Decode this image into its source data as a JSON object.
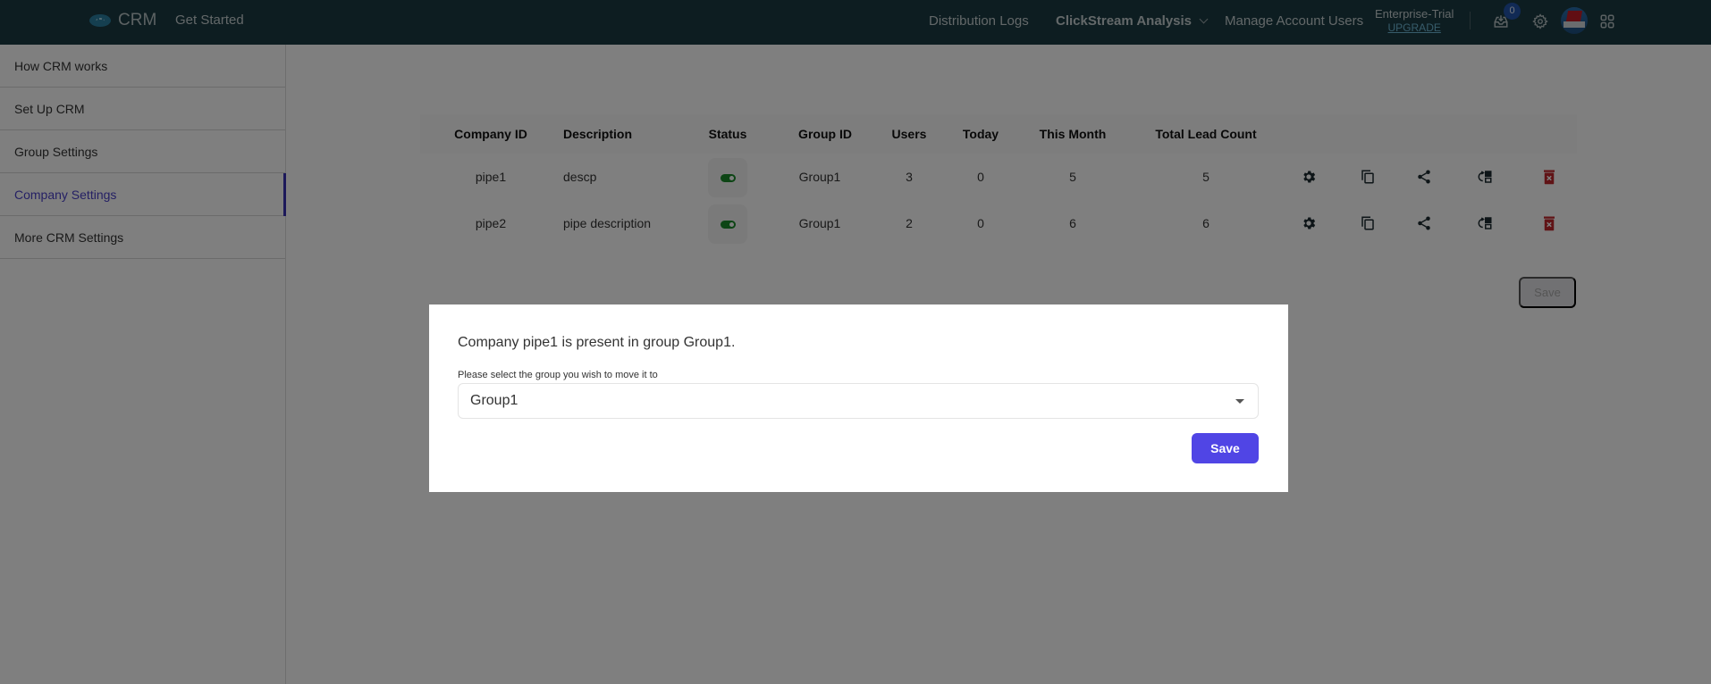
{
  "topbar": {
    "brand": "CRM",
    "get_started": "Get Started",
    "nav": [
      {
        "label": "Distribution Logs"
      },
      {
        "label": "ClickStream Analysis"
      },
      {
        "label": "Manage Account Users"
      }
    ],
    "plan": {
      "name": "Enterprise-Trial",
      "upgrade": "UPGRADE"
    },
    "notifications_count": "0"
  },
  "sidebar": {
    "items": [
      {
        "label": "How CRM works"
      },
      {
        "label": "Set Up CRM"
      },
      {
        "label": "Group Settings"
      },
      {
        "label": "Company Settings",
        "active": true
      },
      {
        "label": "More CRM Settings"
      }
    ]
  },
  "table": {
    "headers": [
      "Company ID",
      "Description",
      "Status",
      "Group ID",
      "Users",
      "Today",
      "This Month",
      "Total Lead Count"
    ],
    "rows": [
      {
        "company_id": "pipe1",
        "description": "descp",
        "status": "on",
        "group_id": "Group1",
        "users": "3",
        "today": "0",
        "this_month": "5",
        "total": "5"
      },
      {
        "company_id": "pipe2",
        "description": "pipe description",
        "status": "on",
        "group_id": "Group1",
        "users": "2",
        "today": "0",
        "this_month": "6",
        "total": "6"
      }
    ],
    "actions": [
      "settings-icon",
      "copy-icon",
      "share-icon",
      "move-group-icon",
      "delete-icon"
    ],
    "save_label": "Save"
  },
  "modal": {
    "message": "Company pipe1 is present in group Group1.",
    "label": "Please select the group you wish to move it to",
    "selected_group": "Group1",
    "save_label": "Save"
  },
  "colors": {
    "topbar_bg": "#1a3a42",
    "accent": "#5045e5",
    "active_sidebar": "#4a41c9",
    "status_on": "#1a8a2a",
    "delete": "#c0262d"
  }
}
